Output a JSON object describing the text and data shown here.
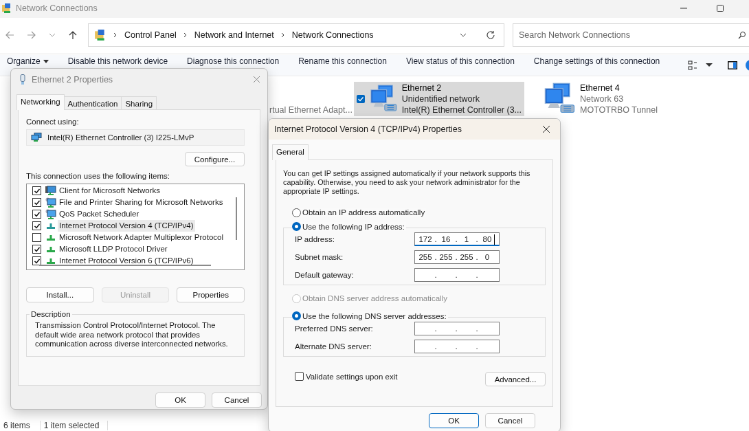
{
  "explorer": {
    "title": "Network Connections",
    "breadcrumbs": [
      "Control Panel",
      "Network and Internet",
      "Network Connections"
    ],
    "search": {
      "placeholder": "Search Network Connections"
    },
    "commands": [
      {
        "label": "Organize",
        "kind": "menu"
      },
      {
        "label": "Disable this network device",
        "kind": "command"
      },
      {
        "label": "Diagnose this connection",
        "kind": "command"
      },
      {
        "label": "Rename this connection",
        "kind": "command"
      },
      {
        "label": "View status of this connection",
        "kind": "command"
      },
      {
        "label": "Change settings of this connection",
        "kind": "command"
      }
    ],
    "connections": [
      {
        "device": "rtual Ethernet Adapt...",
        "selected": false,
        "checked": false,
        "kind": "partial"
      },
      {
        "name": "Ethernet 2",
        "status": "Unidentified network",
        "device": "Intel(R) Ethernet Controller (3...",
        "selected": true,
        "checked": true,
        "kind": "full"
      },
      {
        "name": "Ethernet 4",
        "status": "Network 63",
        "device": "MOTOTRBO Tunnel",
        "selected": false,
        "checked": false,
        "kind": "full"
      }
    ],
    "status_bar": [
      "6 items",
      "1 item selected"
    ]
  },
  "adapter_dialog": {
    "title": "Ethernet 2 Properties",
    "tabs": [
      {
        "label": "Networking",
        "selected": true
      },
      {
        "label": "Authentication",
        "selected": false
      },
      {
        "label": "Sharing",
        "selected": false
      }
    ],
    "connect_using_label": "Connect using:",
    "adapter": "Intel(R) Ethernet Controller (3) I225-LMvP",
    "configure_button": "Configure...",
    "items_label": "This connection uses the following items:",
    "items": [
      {
        "label": "Client for Microsoft Networks",
        "kind": "client",
        "checked": true,
        "selected": false
      },
      {
        "label": "File and Printer Sharing for Microsoft Networks",
        "kind": "service",
        "checked": true,
        "selected": false
      },
      {
        "label": "QoS Packet Scheduler",
        "kind": "service",
        "checked": true,
        "selected": false
      },
      {
        "label": "Internet Protocol Version 4 (TCP/IPv4)",
        "kind": "protocol",
        "checked": true,
        "selected": true
      },
      {
        "label": "Microsoft Network Adapter Multiplexor Protocol",
        "kind": "protocol",
        "checked": false,
        "selected": false
      },
      {
        "label": "Microsoft LLDP Protocol Driver",
        "kind": "protocol",
        "checked": true,
        "selected": false
      },
      {
        "label": "Internet Protocol Version 6 (TCP/IPv6)",
        "kind": "protocol",
        "checked": true,
        "selected": false
      }
    ],
    "buttons": [
      {
        "label": "Install...",
        "disabled": false
      },
      {
        "label": "Uninstall",
        "disabled": true
      },
      {
        "label": "Properties",
        "disabled": false
      }
    ],
    "description_title": "Description",
    "description": "Transmission Control Protocol/Internet Protocol. The default wide area network protocol that provides communication across diverse interconnected networks.",
    "ok": "OK",
    "cancel": "Cancel"
  },
  "ipv4_dialog": {
    "title": "Internet Protocol Version 4 (TCP/IPv4) Properties",
    "tabs": [
      {
        "label": "General",
        "selected": true
      }
    ],
    "intro": "You can get IP settings assigned automatically if your network supports this capability. Otherwise, you need to ask your network administrator for the appropriate IP settings.",
    "separator": ".",
    "ip_auto": {
      "label": "Obtain an IP address automatically",
      "selected": false,
      "disabled": false
    },
    "ip_manual": {
      "label": "Use the following IP address:",
      "selected": true,
      "disabled": false
    },
    "ip_fields": [
      {
        "label": "IP address:",
        "octets": [
          "172",
          "16",
          "1",
          "80"
        ],
        "focused": true
      },
      {
        "label": "Subnet mask:",
        "octets": [
          "255",
          "255",
          "255",
          "0"
        ],
        "focused": false
      },
      {
        "label": "Default gateway:",
        "focused": false
      }
    ],
    "dns_auto": {
      "label": "Obtain DNS server address automatically",
      "selected": false,
      "disabled": true
    },
    "dns_manual": {
      "label": "Use the following DNS server addresses:",
      "selected": true,
      "disabled": false
    },
    "dns_fields": [
      {
        "label": "Preferred DNS server:",
        "focused": false
      },
      {
        "label": "Alternate DNS server:",
        "focused": false
      }
    ],
    "validate": {
      "label": "Validate settings upon exit",
      "checked": false
    },
    "advanced": "Advanced...",
    "ok": "OK",
    "cancel": "Cancel"
  }
}
